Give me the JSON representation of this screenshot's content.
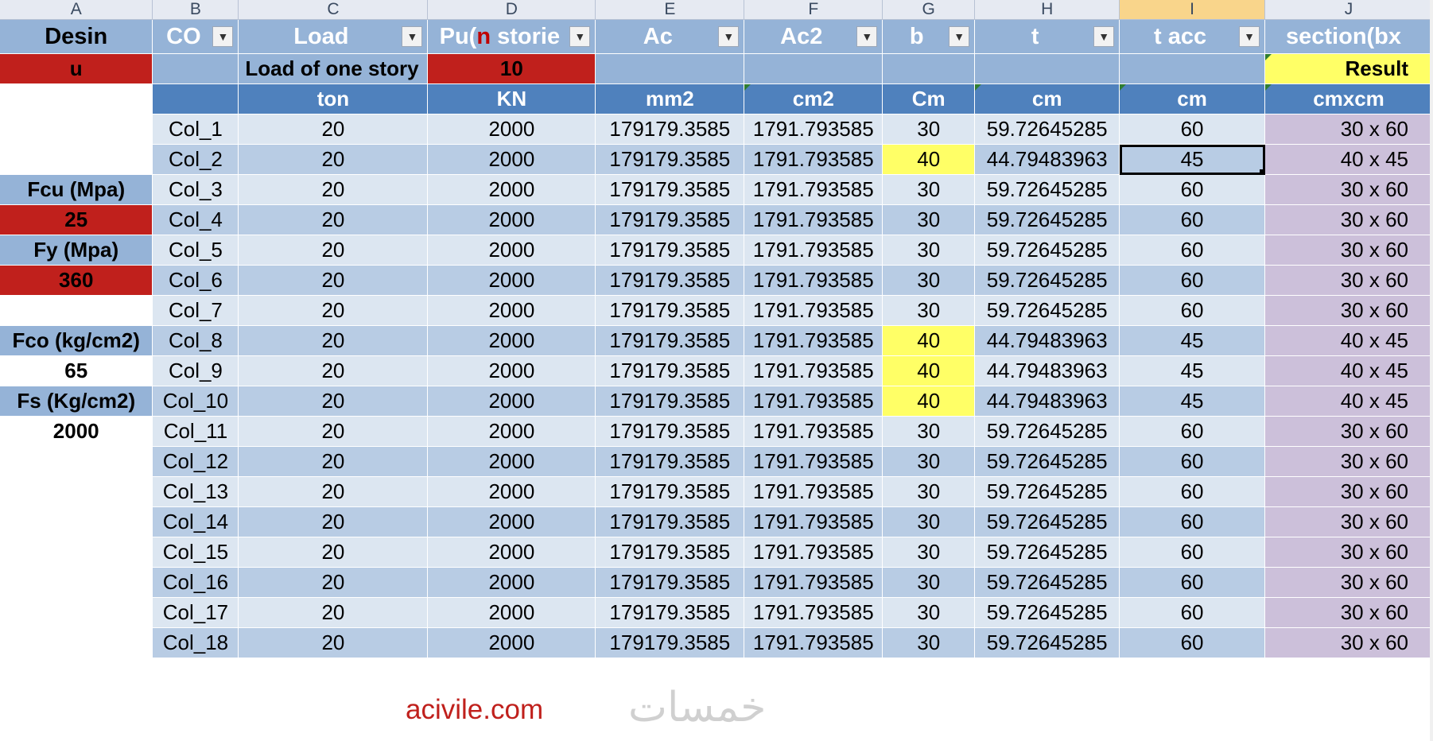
{
  "columns": [
    "A",
    "B",
    "C",
    "D",
    "E",
    "F",
    "G",
    "H",
    "I",
    "J"
  ],
  "selected_column": "I",
  "headers": {
    "a": "Desin",
    "b": "CO",
    "c": "Load",
    "d_pre": "Pu(",
    "d_red": "n",
    "d_post": " storie",
    "e": "Ac",
    "f": "Ac2",
    "g": "b",
    "h": "t",
    "i": "t acc",
    "j": "section(bx"
  },
  "row2": {
    "a": "u",
    "c": "Load of one story",
    "d": "10",
    "j": "Result"
  },
  "units": {
    "c": "ton",
    "d": "KN",
    "e": "mm2",
    "f": "cm2",
    "g": "Cm",
    "h": "cm",
    "i": "cm",
    "j": "cmxcm"
  },
  "side_params": [
    "",
    "",
    "Fcu (Mpa)",
    "25",
    "Fy (Mpa)",
    "360",
    "",
    "Fco (kg/cm2)",
    "65",
    "Fs (Kg/cm2)",
    "2000",
    "",
    "",
    "",
    "",
    "",
    "",
    ""
  ],
  "rows": [
    {
      "col": "Col_1",
      "load": "20",
      "pu": "2000",
      "ac": "179179.3585",
      "ac2": "1791.793585",
      "b": "30",
      "t": "59.72645285",
      "tacc": "60",
      "section": "30 x 60"
    },
    {
      "col": "Col_2",
      "load": "20",
      "pu": "2000",
      "ac": "179179.3585",
      "ac2": "1791.793585",
      "b": "40",
      "t": "44.79483963",
      "tacc": "45",
      "section": "40 x 45"
    },
    {
      "col": "Col_3",
      "load": "20",
      "pu": "2000",
      "ac": "179179.3585",
      "ac2": "1791.793585",
      "b": "30",
      "t": "59.72645285",
      "tacc": "60",
      "section": "30 x 60"
    },
    {
      "col": "Col_4",
      "load": "20",
      "pu": "2000",
      "ac": "179179.3585",
      "ac2": "1791.793585",
      "b": "30",
      "t": "59.72645285",
      "tacc": "60",
      "section": "30 x 60"
    },
    {
      "col": "Col_5",
      "load": "20",
      "pu": "2000",
      "ac": "179179.3585",
      "ac2": "1791.793585",
      "b": "30",
      "t": "59.72645285",
      "tacc": "60",
      "section": "30 x 60"
    },
    {
      "col": "Col_6",
      "load": "20",
      "pu": "2000",
      "ac": "179179.3585",
      "ac2": "1791.793585",
      "b": "30",
      "t": "59.72645285",
      "tacc": "60",
      "section": "30 x 60"
    },
    {
      "col": "Col_7",
      "load": "20",
      "pu": "2000",
      "ac": "179179.3585",
      "ac2": "1791.793585",
      "b": "30",
      "t": "59.72645285",
      "tacc": "60",
      "section": "30 x 60"
    },
    {
      "col": "Col_8",
      "load": "20",
      "pu": "2000",
      "ac": "179179.3585",
      "ac2": "1791.793585",
      "b": "40",
      "t": "44.79483963",
      "tacc": "45",
      "section": "40 x 45"
    },
    {
      "col": "Col_9",
      "load": "20",
      "pu": "2000",
      "ac": "179179.3585",
      "ac2": "1791.793585",
      "b": "40",
      "t": "44.79483963",
      "tacc": "45",
      "section": "40 x 45"
    },
    {
      "col": "Col_10",
      "load": "20",
      "pu": "2000",
      "ac": "179179.3585",
      "ac2": "1791.793585",
      "b": "40",
      "t": "44.79483963",
      "tacc": "45",
      "section": "40 x 45"
    },
    {
      "col": "Col_11",
      "load": "20",
      "pu": "2000",
      "ac": "179179.3585",
      "ac2": "1791.793585",
      "b": "30",
      "t": "59.72645285",
      "tacc": "60",
      "section": "30 x 60"
    },
    {
      "col": "Col_12",
      "load": "20",
      "pu": "2000",
      "ac": "179179.3585",
      "ac2": "1791.793585",
      "b": "30",
      "t": "59.72645285",
      "tacc": "60",
      "section": "30 x 60"
    },
    {
      "col": "Col_13",
      "load": "20",
      "pu": "2000",
      "ac": "179179.3585",
      "ac2": "1791.793585",
      "b": "30",
      "t": "59.72645285",
      "tacc": "60",
      "section": "30 x 60"
    },
    {
      "col": "Col_14",
      "load": "20",
      "pu": "2000",
      "ac": "179179.3585",
      "ac2": "1791.793585",
      "b": "30",
      "t": "59.72645285",
      "tacc": "60",
      "section": "30 x 60"
    },
    {
      "col": "Col_15",
      "load": "20",
      "pu": "2000",
      "ac": "179179.3585",
      "ac2": "1791.793585",
      "b": "30",
      "t": "59.72645285",
      "tacc": "60",
      "section": "30 x 60"
    },
    {
      "col": "Col_16",
      "load": "20",
      "pu": "2000",
      "ac": "179179.3585",
      "ac2": "1791.793585",
      "b": "30",
      "t": "59.72645285",
      "tacc": "60",
      "section": "30 x 60"
    },
    {
      "col": "Col_17",
      "load": "20",
      "pu": "2000",
      "ac": "179179.3585",
      "ac2": "1791.793585",
      "b": "30",
      "t": "59.72645285",
      "tacc": "60",
      "section": "30 x 60"
    },
    {
      "col": "Col_18",
      "load": "20",
      "pu": "2000",
      "ac": "179179.3585",
      "ac2": "1791.793585",
      "b": "30",
      "t": "59.72645285",
      "tacc": "60",
      "section": "30 x 60"
    }
  ],
  "footer": {
    "site": "acivile.com",
    "logo": "خمسات"
  }
}
